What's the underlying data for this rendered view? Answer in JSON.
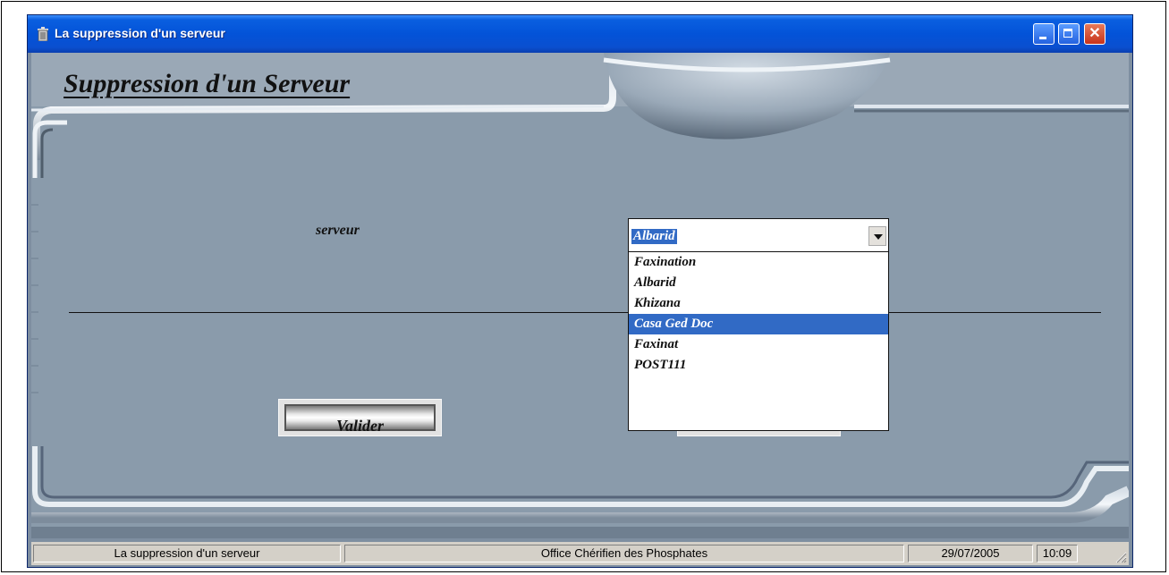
{
  "window": {
    "title": "La suppression d'un serveur",
    "buttons": {
      "minimize": "minimize-icon",
      "maximize": "maximize-icon",
      "close": "close-icon"
    }
  },
  "form": {
    "heading": "Suppression d'un Serveur",
    "field_label": "serveur",
    "combo": {
      "selected": "Albarid",
      "options": [
        "Faxination",
        "Albarid",
        "Khizana",
        "Casa Ged Doc",
        "Faxinat",
        "POST111"
      ],
      "highlighted_index": 3
    },
    "valider_label": "Valider"
  },
  "statusbar": {
    "pane1": "La suppression d'un serveur",
    "pane2": "Office Chérifien des Phosphates",
    "date": "29/07/2005",
    "time": "10:09"
  },
  "colors": {
    "titlebar": "#0353d8",
    "client_bg": "#8a9bab",
    "selection": "#316ac5",
    "statusbar": "#d4d0c8"
  }
}
